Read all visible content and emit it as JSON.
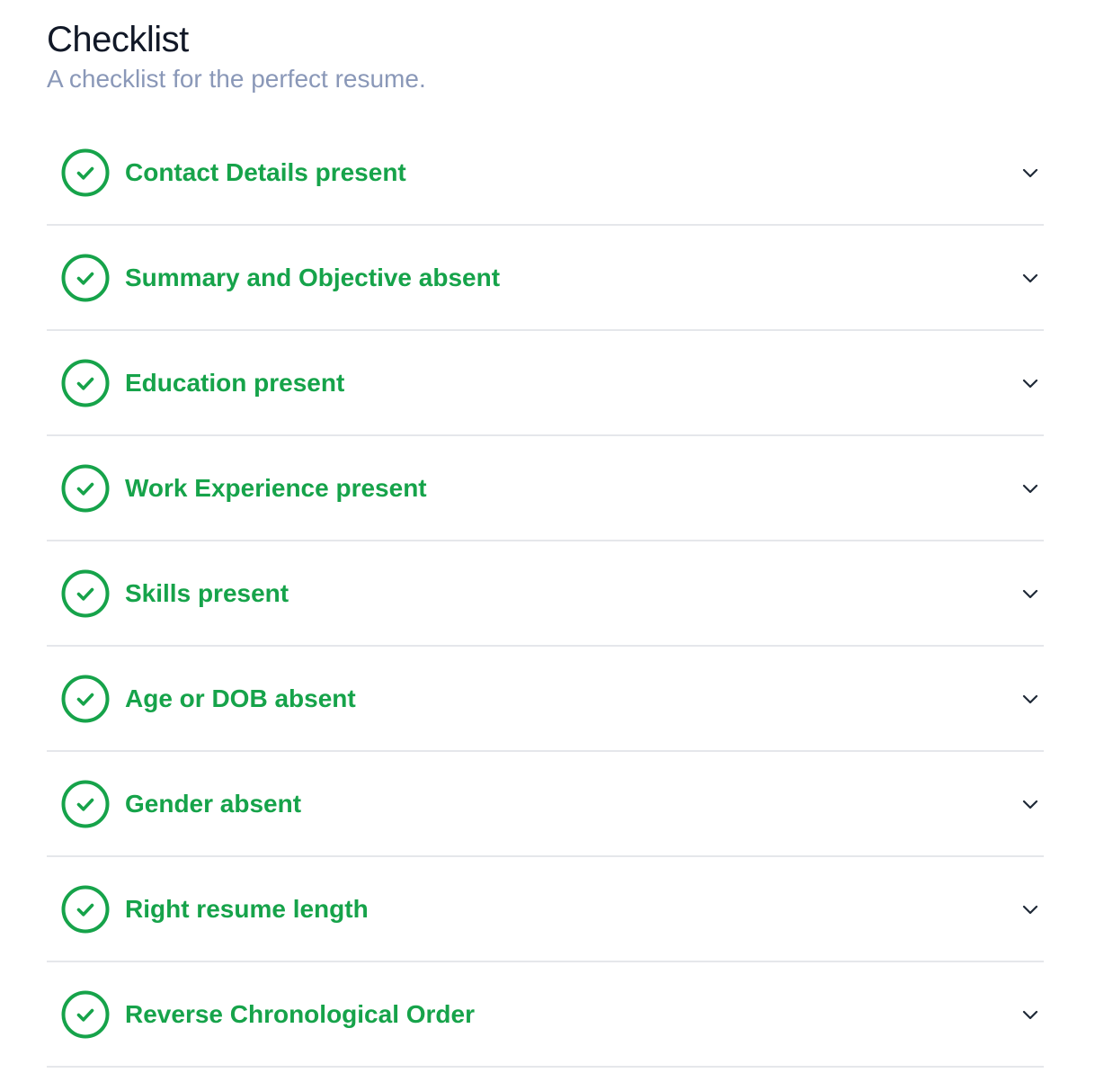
{
  "header": {
    "title": "Checklist",
    "subtitle": "A checklist for the perfect resume."
  },
  "theme": {
    "accent": "#16a34a",
    "title_color": "#111827",
    "subtitle_color": "#8a98b8",
    "divider": "#e5e7eb"
  },
  "items": [
    {
      "label": "Contact Details present",
      "status": "passed",
      "icon": "check-circle-icon",
      "expanded": false
    },
    {
      "label": "Summary and Objective absent",
      "status": "passed",
      "icon": "check-circle-icon",
      "expanded": false
    },
    {
      "label": "Education present",
      "status": "passed",
      "icon": "check-circle-icon",
      "expanded": false
    },
    {
      "label": "Work Experience present",
      "status": "passed",
      "icon": "check-circle-icon",
      "expanded": false
    },
    {
      "label": "Skills present",
      "status": "passed",
      "icon": "check-circle-icon",
      "expanded": false
    },
    {
      "label": "Age or DOB absent",
      "status": "passed",
      "icon": "check-circle-icon",
      "expanded": false
    },
    {
      "label": "Gender absent",
      "status": "passed",
      "icon": "check-circle-icon",
      "expanded": false
    },
    {
      "label": "Right resume length",
      "status": "passed",
      "icon": "check-circle-icon",
      "expanded": false
    },
    {
      "label": "Reverse Chronological Order",
      "status": "passed",
      "icon": "check-circle-icon",
      "expanded": false
    }
  ]
}
